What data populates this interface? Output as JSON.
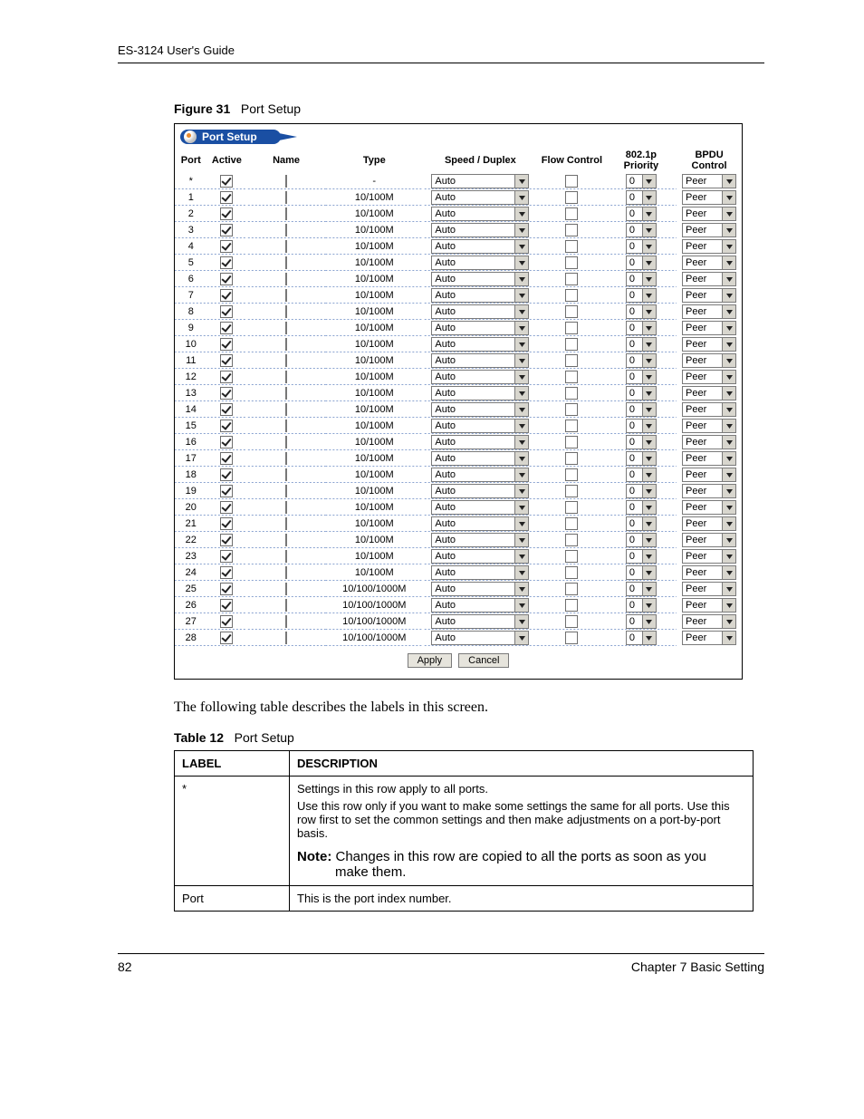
{
  "header": {
    "guide_title": "ES-3124 User's Guide"
  },
  "figure": {
    "label": "Figure 31",
    "title": "Port Setup"
  },
  "panel": {
    "title": "Port Setup",
    "columns": {
      "port": "Port",
      "active": "Active",
      "name": "Name",
      "type": "Type",
      "speed": "Speed / Duplex",
      "flow": "Flow Control",
      "priority": "802.1p Priority",
      "bpdu": "BPDU Control"
    },
    "rows": [
      {
        "port": "*",
        "active": true,
        "name": "",
        "type": "-",
        "speed": "Auto",
        "flow": false,
        "priority": "0",
        "bpdu": "Peer"
      },
      {
        "port": "1",
        "active": true,
        "name": "",
        "type": "10/100M",
        "speed": "Auto",
        "flow": false,
        "priority": "0",
        "bpdu": "Peer"
      },
      {
        "port": "2",
        "active": true,
        "name": "",
        "type": "10/100M",
        "speed": "Auto",
        "flow": false,
        "priority": "0",
        "bpdu": "Peer"
      },
      {
        "port": "3",
        "active": true,
        "name": "",
        "type": "10/100M",
        "speed": "Auto",
        "flow": false,
        "priority": "0",
        "bpdu": "Peer"
      },
      {
        "port": "4",
        "active": true,
        "name": "",
        "type": "10/100M",
        "speed": "Auto",
        "flow": false,
        "priority": "0",
        "bpdu": "Peer"
      },
      {
        "port": "5",
        "active": true,
        "name": "",
        "type": "10/100M",
        "speed": "Auto",
        "flow": false,
        "priority": "0",
        "bpdu": "Peer"
      },
      {
        "port": "6",
        "active": true,
        "name": "",
        "type": "10/100M",
        "speed": "Auto",
        "flow": false,
        "priority": "0",
        "bpdu": "Peer"
      },
      {
        "port": "7",
        "active": true,
        "name": "",
        "type": "10/100M",
        "speed": "Auto",
        "flow": false,
        "priority": "0",
        "bpdu": "Peer"
      },
      {
        "port": "8",
        "active": true,
        "name": "",
        "type": "10/100M",
        "speed": "Auto",
        "flow": false,
        "priority": "0",
        "bpdu": "Peer"
      },
      {
        "port": "9",
        "active": true,
        "name": "",
        "type": "10/100M",
        "speed": "Auto",
        "flow": false,
        "priority": "0",
        "bpdu": "Peer"
      },
      {
        "port": "10",
        "active": true,
        "name": "",
        "type": "10/100M",
        "speed": "Auto",
        "flow": false,
        "priority": "0",
        "bpdu": "Peer"
      },
      {
        "port": "11",
        "active": true,
        "name": "",
        "type": "10/100M",
        "speed": "Auto",
        "flow": false,
        "priority": "0",
        "bpdu": "Peer"
      },
      {
        "port": "12",
        "active": true,
        "name": "",
        "type": "10/100M",
        "speed": "Auto",
        "flow": false,
        "priority": "0",
        "bpdu": "Peer"
      },
      {
        "port": "13",
        "active": true,
        "name": "",
        "type": "10/100M",
        "speed": "Auto",
        "flow": false,
        "priority": "0",
        "bpdu": "Peer"
      },
      {
        "port": "14",
        "active": true,
        "name": "",
        "type": "10/100M",
        "speed": "Auto",
        "flow": false,
        "priority": "0",
        "bpdu": "Peer"
      },
      {
        "port": "15",
        "active": true,
        "name": "",
        "type": "10/100M",
        "speed": "Auto",
        "flow": false,
        "priority": "0",
        "bpdu": "Peer"
      },
      {
        "port": "16",
        "active": true,
        "name": "",
        "type": "10/100M",
        "speed": "Auto",
        "flow": false,
        "priority": "0",
        "bpdu": "Peer"
      },
      {
        "port": "17",
        "active": true,
        "name": "",
        "type": "10/100M",
        "speed": "Auto",
        "flow": false,
        "priority": "0",
        "bpdu": "Peer"
      },
      {
        "port": "18",
        "active": true,
        "name": "",
        "type": "10/100M",
        "speed": "Auto",
        "flow": false,
        "priority": "0",
        "bpdu": "Peer"
      },
      {
        "port": "19",
        "active": true,
        "name": "",
        "type": "10/100M",
        "speed": "Auto",
        "flow": false,
        "priority": "0",
        "bpdu": "Peer"
      },
      {
        "port": "20",
        "active": true,
        "name": "",
        "type": "10/100M",
        "speed": "Auto",
        "flow": false,
        "priority": "0",
        "bpdu": "Peer"
      },
      {
        "port": "21",
        "active": true,
        "name": "",
        "type": "10/100M",
        "speed": "Auto",
        "flow": false,
        "priority": "0",
        "bpdu": "Peer"
      },
      {
        "port": "22",
        "active": true,
        "name": "",
        "type": "10/100M",
        "speed": "Auto",
        "flow": false,
        "priority": "0",
        "bpdu": "Peer"
      },
      {
        "port": "23",
        "active": true,
        "name": "",
        "type": "10/100M",
        "speed": "Auto",
        "flow": false,
        "priority": "0",
        "bpdu": "Peer"
      },
      {
        "port": "24",
        "active": true,
        "name": "",
        "type": "10/100M",
        "speed": "Auto",
        "flow": false,
        "priority": "0",
        "bpdu": "Peer"
      },
      {
        "port": "25",
        "active": true,
        "name": "",
        "type": "10/100/1000M",
        "speed": "Auto",
        "flow": false,
        "priority": "0",
        "bpdu": "Peer"
      },
      {
        "port": "26",
        "active": true,
        "name": "",
        "type": "10/100/1000M",
        "speed": "Auto",
        "flow": false,
        "priority": "0",
        "bpdu": "Peer"
      },
      {
        "port": "27",
        "active": true,
        "name": "",
        "type": "10/100/1000M",
        "speed": "Auto",
        "flow": false,
        "priority": "0",
        "bpdu": "Peer"
      },
      {
        "port": "28",
        "active": true,
        "name": "",
        "type": "10/100/1000M",
        "speed": "Auto",
        "flow": false,
        "priority": "0",
        "bpdu": "Peer"
      }
    ],
    "buttons": {
      "apply": "Apply",
      "cancel": "Cancel"
    }
  },
  "body_text": "The following table describes the labels in this screen.",
  "table_caption": {
    "label": "Table 12",
    "title": "Port Setup"
  },
  "desc_table": {
    "header": {
      "label": "LABEL",
      "description": "DESCRIPTION"
    },
    "rows": [
      {
        "label": "*",
        "d1": "Settings in this row apply to all ports.",
        "d2": "Use this row only if you want to make some settings the same for all ports. Use this row first to set the common settings and then make adjustments on a port-by-port basis.",
        "note_bold": "Note:",
        "note_rest": " Changes in this row are copied to all the ports as soon as you",
        "note_line2": "make them."
      },
      {
        "label": "Port",
        "d1": "This is the port index number."
      }
    ]
  },
  "footer": {
    "page": "82",
    "chapter": "Chapter 7 Basic Setting"
  }
}
